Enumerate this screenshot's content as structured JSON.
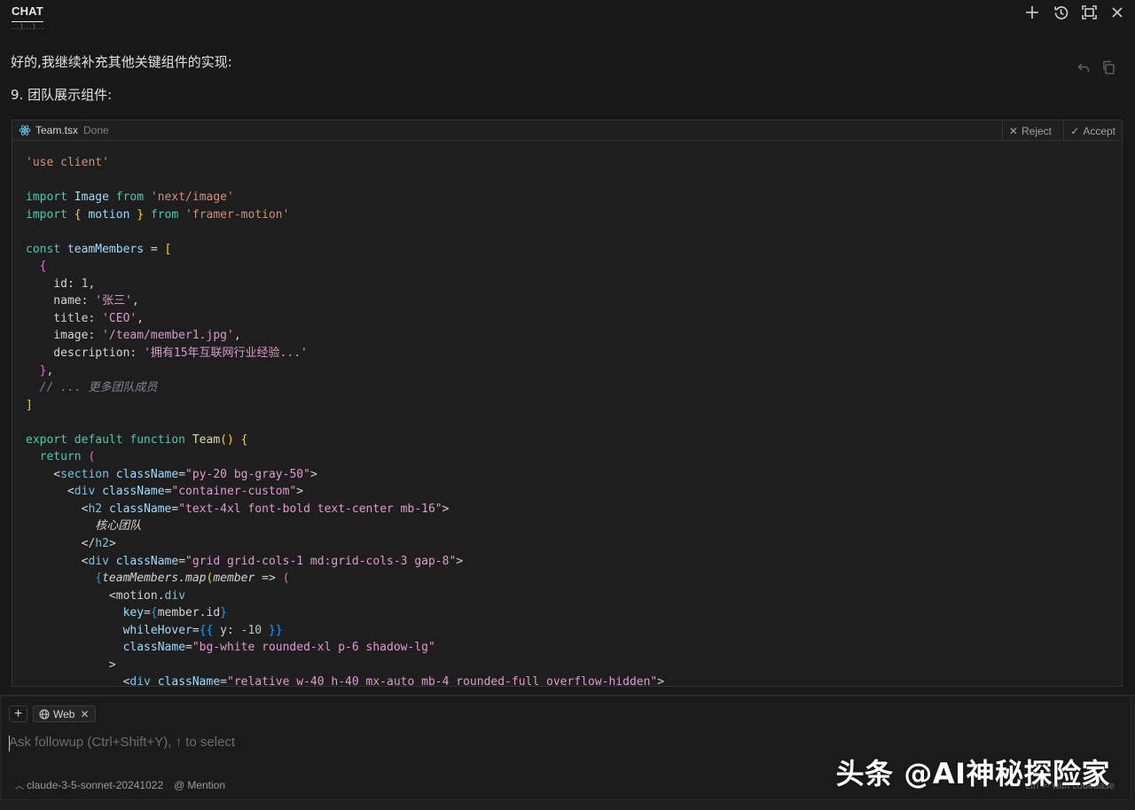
{
  "header": {
    "tab_label": "CHAT",
    "icons": [
      "plus-icon",
      "history-icon",
      "maximize-icon",
      "close-icon"
    ]
  },
  "message": {
    "faded_prev": "...)...)...",
    "line1": "好的,我继续补充其他关键组件的实现:",
    "line2": "9. 团队展示组件:",
    "actions": [
      "undo-icon",
      "copy-icon"
    ]
  },
  "code_block": {
    "file_name": "Team.tsx",
    "status": "Done",
    "reject_label": "Reject",
    "accept_label": "Accept",
    "language": "tsx"
  },
  "composer": {
    "context_chip": "Web",
    "placeholder": "Ask followup (Ctrl+Shift+Y), ↑ to select",
    "model": "claude-3-5-sonnet-20241022",
    "mention_label": "Mention",
    "right_hint": "ctrl ⏎ with codebase"
  },
  "watermark": {
    "text": "头条 @AI神秘探险家"
  },
  "colors": {
    "background": "#181818",
    "code_bg": "#1e1e1e",
    "keyword": "#4ec9b0",
    "string": "#ce9178",
    "jsx_string": "#e09ad0"
  }
}
